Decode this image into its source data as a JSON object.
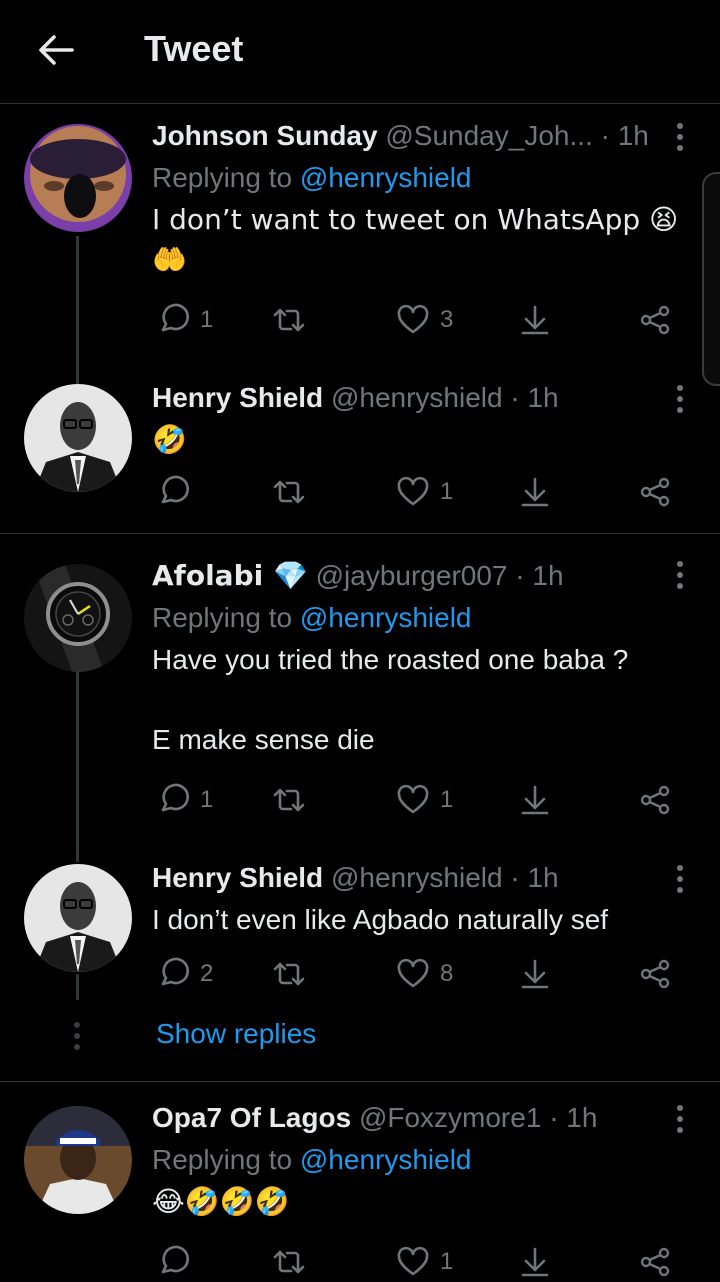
{
  "header": {
    "title": "Tweet"
  },
  "tweets": [
    {
      "name": "Johnson Sunday",
      "handle": "@Sunday_Joh...",
      "time": "· 1h",
      "replying_prefix": "Replying to ",
      "replying_to": "@henryshield",
      "text": "I don’t want to tweet on WhatsApp 😫\n🤲",
      "replies": "1",
      "retweets": "",
      "likes": "3"
    },
    {
      "name": "Henry Shield",
      "handle": "@henryshield",
      "time": "· 1h",
      "text": "🤣",
      "replies": "",
      "retweets": "",
      "likes": "1"
    },
    {
      "name": "Afolabi 💎",
      "handle": "@jayburger007",
      "time": "· 1h",
      "replying_prefix": "Replying to ",
      "replying_to": "@henryshield",
      "text": "Have you tried the roasted one baba ?\n\nE make sense die",
      "replies": "1",
      "retweets": "",
      "likes": "1"
    },
    {
      "name": "Henry Shield",
      "handle": "@henryshield",
      "time": "· 1h",
      "text": "I don’t even like Agbado naturally sef",
      "replies": "2",
      "retweets": "",
      "likes": "8"
    },
    {
      "name": "Opa7 Of Lagos",
      "handle": "@Foxzymore1",
      "time": "· 1h",
      "replying_prefix": "Replying to ",
      "replying_to": "@henryshield",
      "text": "😂🤣🤣🤣",
      "replies": "",
      "retweets": "",
      "likes": "1"
    }
  ],
  "show_replies": "Show replies",
  "colors": {
    "accent": "#1d9bf0",
    "muted": "#71767b",
    "text": "#e7e9ea",
    "background": "#000000"
  }
}
